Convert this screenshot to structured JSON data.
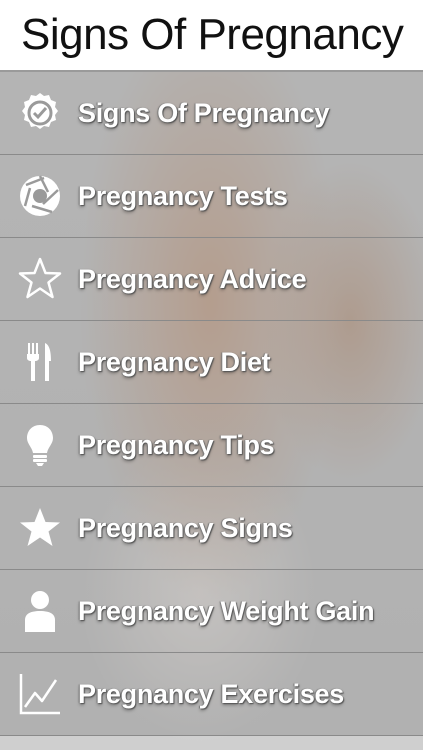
{
  "header": {
    "title": "Signs Of Pregnancy"
  },
  "menu": {
    "items": [
      {
        "label": "Signs Of Pregnancy",
        "icon": "badge-check-icon"
      },
      {
        "label": "Pregnancy Tests",
        "icon": "aperture-icon"
      },
      {
        "label": "Pregnancy Advice",
        "icon": "star-outline-icon"
      },
      {
        "label": "Pregnancy Diet",
        "icon": "fork-knife-icon"
      },
      {
        "label": "Pregnancy Tips",
        "icon": "lightbulb-icon"
      },
      {
        "label": "Pregnancy Signs",
        "icon": "star-filled-icon"
      },
      {
        "label": "Pregnancy Weight Gain",
        "icon": "person-icon"
      },
      {
        "label": "Pregnancy Exercises",
        "icon": "chart-line-icon"
      }
    ]
  }
}
